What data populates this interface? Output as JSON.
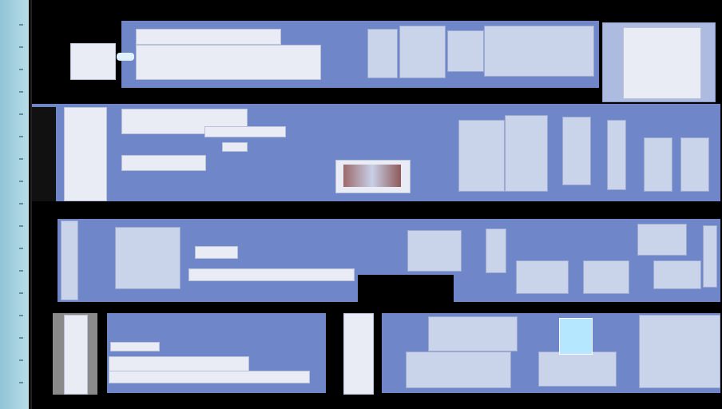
{
  "title": "",
  "rows": [
    {
      "name": "row-1"
    },
    {
      "name": "row-2"
    },
    {
      "name": "row-3"
    },
    {
      "name": "row-4"
    }
  ]
}
